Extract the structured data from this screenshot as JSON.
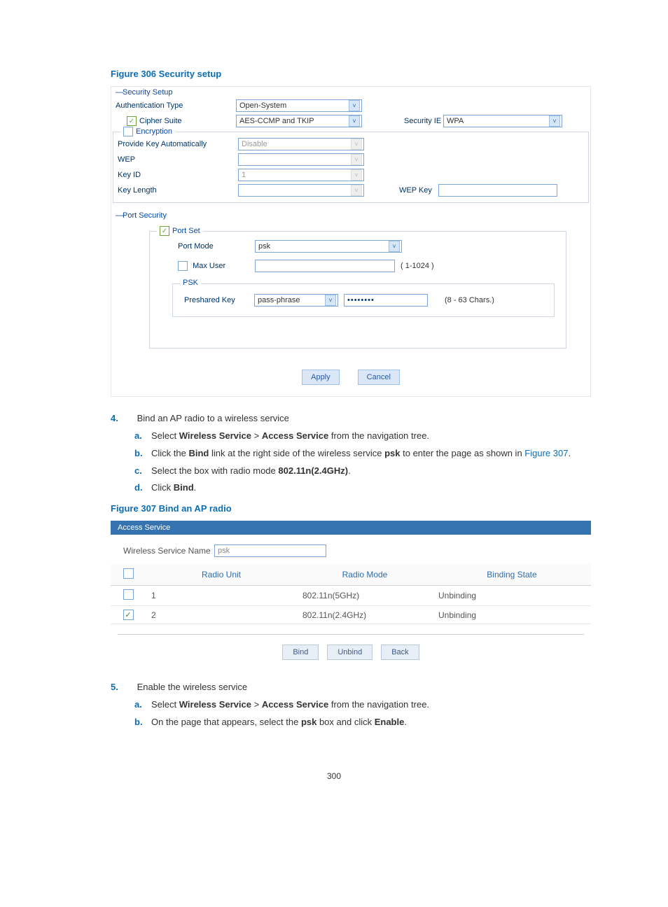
{
  "figure306": {
    "caption": "Figure 306 Security setup",
    "security_setup_title": "Security Setup",
    "auth_type_label": "Authentication Type",
    "auth_type_value": "Open-System",
    "cipher_suite_label": "Cipher Suite",
    "cipher_suite_value": "AES-CCMP and TKIP",
    "security_ie_label": "Security IE",
    "security_ie_value": "WPA",
    "encryption_label": "Encryption",
    "provide_key_label": "Provide Key Automatically",
    "provide_key_value": "Disable",
    "wep_label": "WEP",
    "wep_value": "",
    "keyid_label": "Key ID",
    "keyid_value": "1",
    "keylength_label": "Key Length",
    "keylength_value": "",
    "wepkey_label": "WEP Key",
    "wepkey_value": "",
    "port_security_title": "Port Security",
    "portset_label": "Port Set",
    "portmode_label": "Port Mode",
    "portmode_value": "psk",
    "maxuser_label": "Max User",
    "maxuser_hint": "( 1-1024 )",
    "psk_label": "PSK",
    "preshared_label": "Preshared Key",
    "psk_type_value": "pass-phrase",
    "psk_value": "••••••••",
    "psk_hint": "(8 - 63 Chars.)",
    "apply_btn": "Apply",
    "cancel_btn": "Cancel"
  },
  "step4": {
    "num": "4.",
    "title": "Bind an AP radio to a wireless service",
    "a": {
      "let": "a.",
      "t1": "Select ",
      "b1": "Wireless Service",
      "t2": " > ",
      "b2": "Access Service",
      "t3": " from the navigation tree."
    },
    "b": {
      "let": "b.",
      "t1": "Click the ",
      "b1": "Bind",
      "t2": " link at the right side of the wireless service ",
      "b2": "psk",
      "t3": " to enter the page as shown in ",
      "link": "Figure 307",
      "t4": "."
    },
    "c": {
      "let": "c.",
      "t1": "Select the box with radio mode ",
      "b1": "802.11n(2.4GHz)",
      "t2": "."
    },
    "d": {
      "let": "d.",
      "t1": "Click ",
      "b1": "Bind",
      "t2": "."
    }
  },
  "figure307": {
    "caption": "Figure 307 Bind an AP radio",
    "tab": "Access Service",
    "ws_label": "Wireless Service Name",
    "ws_value": "psk",
    "cols": {
      "radio_unit": "Radio Unit",
      "radio_mode": "Radio Mode",
      "binding_state": "Binding State"
    },
    "rows": [
      {
        "checked": false,
        "unit": "1",
        "mode": "802.11n(5GHz)",
        "state": "Unbinding"
      },
      {
        "checked": true,
        "unit": "2",
        "mode": "802.11n(2.4GHz)",
        "state": "Unbinding"
      }
    ],
    "bind_btn": "Bind",
    "unbind_btn": "Unbind",
    "back_btn": "Back"
  },
  "step5": {
    "num": "5.",
    "title": "Enable the wireless service",
    "a": {
      "let": "a.",
      "t1": "Select ",
      "b1": "Wireless Service",
      "t2": " > ",
      "b2": "Access Service",
      "t3": " from the navigation tree."
    },
    "b": {
      "let": "b.",
      "t1": "On the page that appears, select the ",
      "b1": "psk",
      "t2": " box and click ",
      "b2": "Enable",
      "t3": "."
    }
  },
  "page_number": "300"
}
